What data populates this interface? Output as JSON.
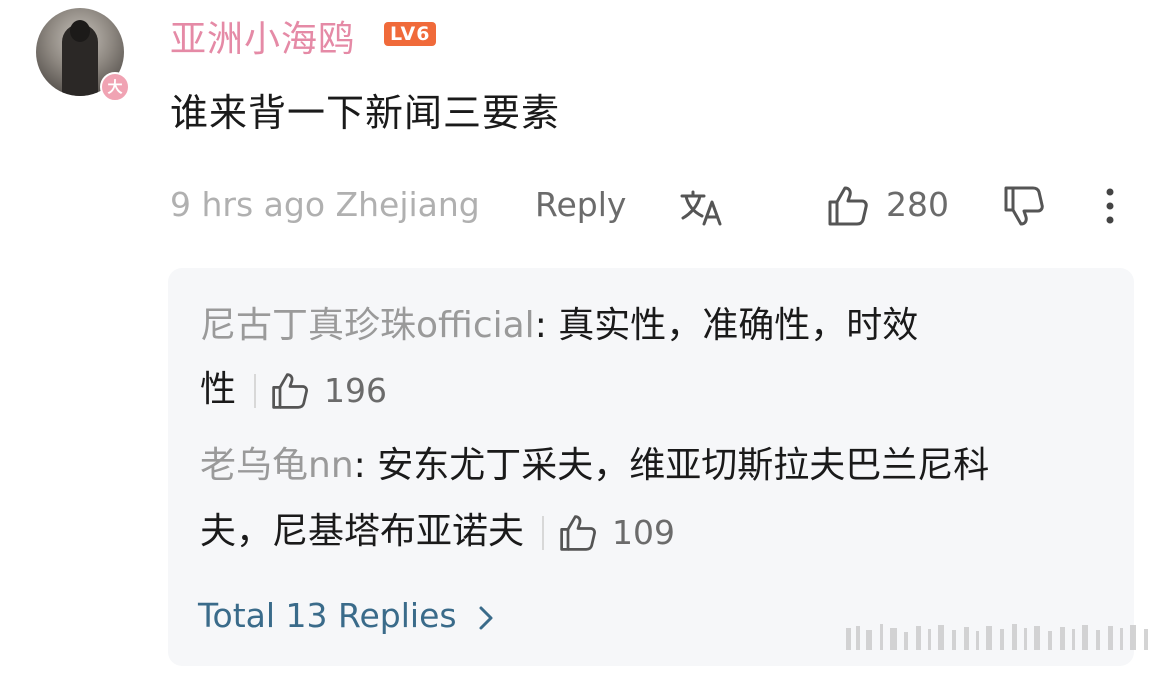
{
  "comment": {
    "username": "亚洲小海鸥",
    "level": "LV6",
    "avatar_badge": "大",
    "text": "谁来背一下新闻三要素",
    "meta": "9 hrs ago Zhejiang",
    "reply_label": "Reply",
    "like_count": "280"
  },
  "replies": [
    {
      "name": "尼古丁真珍珠official",
      "sep": ": ",
      "text_line1": "真实性，准确性，时效",
      "text_line2": "性",
      "likes": "196"
    },
    {
      "name": "老乌龟nn",
      "sep": ": ",
      "text_line1": "安东尤丁采夫，维亚切斯拉夫巴兰尼科",
      "text_line2": "夫，尼基塔布亚诺夫",
      "likes": "109"
    }
  ],
  "total_replies": "Total 13 Replies",
  "icons": {
    "translate": "translate-icon",
    "like": "thumbs-up-icon",
    "dislike": "thumbs-down-icon",
    "more": "more-vertical-icon",
    "chevron": "chevron-right-icon"
  },
  "colors": {
    "username": "#e58aa6",
    "level_badge": "#f06a3a",
    "link": "#3a6b8a",
    "reply_name": "#9a9a9a",
    "meta": "#b0b0b0"
  }
}
